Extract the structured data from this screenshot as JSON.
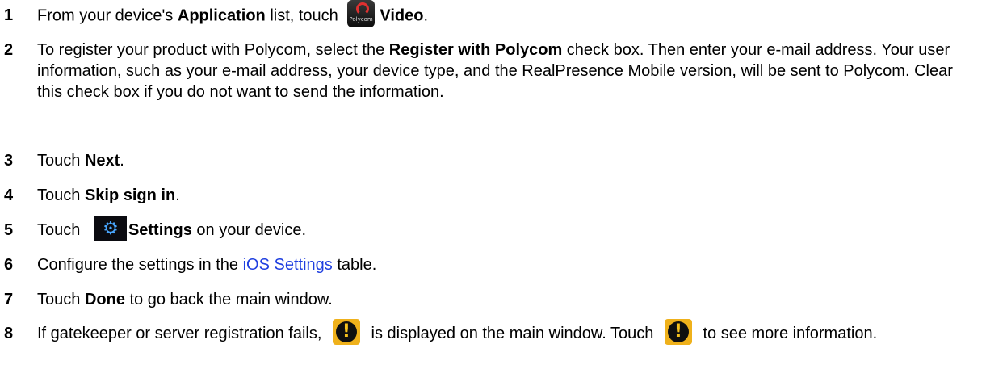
{
  "steps": [
    {
      "number": "1",
      "parts": {
        "t1": "From your device's ",
        "b1": "Application",
        "t2": " list, touch ",
        "b2": "Video",
        "t3": "."
      }
    },
    {
      "number": "2",
      "parts": {
        "t1": "To register your product with Polycom, select the ",
        "b1": "Register with Polycom",
        "t2": " check box. Then enter your e-mail address. Your user information, such as your e-mail address, your device type, and the RealPresence Mobile version, will be sent to Polycom. Clear this check box if you do not want to send the information."
      }
    },
    {
      "number": "3",
      "parts": {
        "t1": "Touch ",
        "b1": "Next",
        "t2": "."
      }
    },
    {
      "number": "4",
      "parts": {
        "t1": "Touch ",
        "b1": "Skip sign in",
        "t2": "."
      }
    },
    {
      "number": "5",
      "parts": {
        "t1": "Touch ",
        "b1": "Settings",
        "t2": " on your device."
      }
    },
    {
      "number": "6",
      "parts": {
        "t1": "Configure the settings in the ",
        "link": "iOS Settings",
        "t2": " table."
      }
    },
    {
      "number": "7",
      "parts": {
        "t1": "Touch ",
        "b1": "Done",
        "t2": " to go back the main window."
      }
    },
    {
      "number": "8",
      "parts": {
        "t1": "If gatekeeper or server registration fails, ",
        "t2": " is displayed on the main window. Touch ",
        "t3": " to see more information."
      }
    }
  ],
  "icons": {
    "polycom_app": "polycom-app-icon",
    "polycom_brand": "Polycom",
    "settings": "gear-icon",
    "settings_glyph": "⚙",
    "warning": "warning-icon",
    "warning_glyph": "!"
  },
  "colors": {
    "link": "#1f3fe0",
    "warning": "#efb11b",
    "settings_icon": "#49a7ff"
  }
}
